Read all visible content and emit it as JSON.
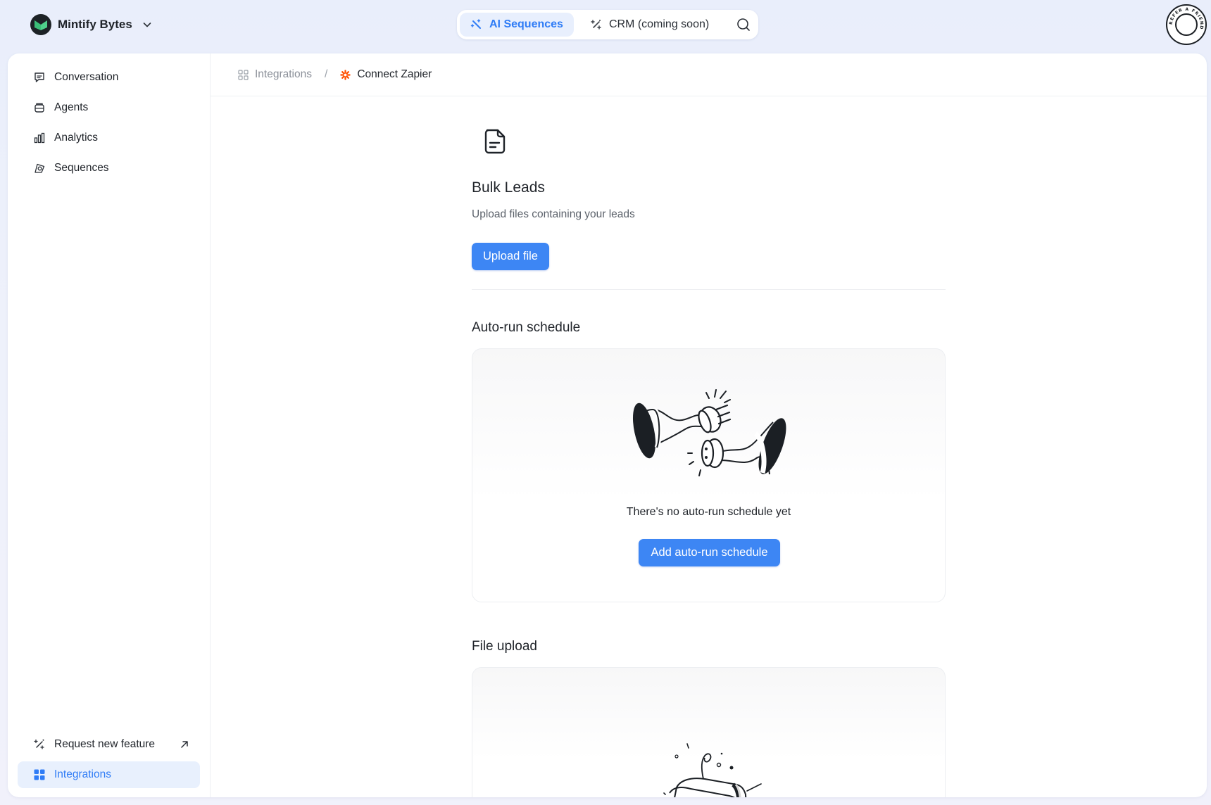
{
  "workspace": {
    "name": "Mintify Bytes"
  },
  "mode_switch": {
    "active_tab": "AI Sequences",
    "inactive_tab": "CRM (coming soon)"
  },
  "refer_badge": {
    "text": "REFER A FRIEND"
  },
  "sidebar": {
    "items": [
      {
        "label": "Conversation",
        "icon": "chat-bubble-icon"
      },
      {
        "label": "Agents",
        "icon": "agents-icon"
      },
      {
        "label": "Analytics",
        "icon": "bar-chart-icon"
      },
      {
        "label": "Sequences",
        "icon": "target-icon"
      }
    ],
    "bottom_items": [
      {
        "label": "Request new feature",
        "icon": "magic-wand-icon"
      },
      {
        "label": "Integrations",
        "icon": "grid-icon",
        "active": true
      }
    ]
  },
  "breadcrumb": {
    "parent": "Integrations",
    "separator": "/",
    "current": "Connect Zapier"
  },
  "bulk_leads": {
    "title": "Bulk Leads",
    "subtitle": "Upload files containing your leads",
    "upload_button": "Upload file"
  },
  "auto_run": {
    "title": "Auto-run schedule",
    "empty_text": "There's no auto-run schedule yet",
    "add_button": "Add auto-run schedule"
  },
  "file_upload": {
    "title": "File upload"
  },
  "colors": {
    "accent": "#3d86f4",
    "active_bg": "#e8f0fd",
    "zapier": "#ff4f00",
    "logo_green": "#4fd18b"
  }
}
